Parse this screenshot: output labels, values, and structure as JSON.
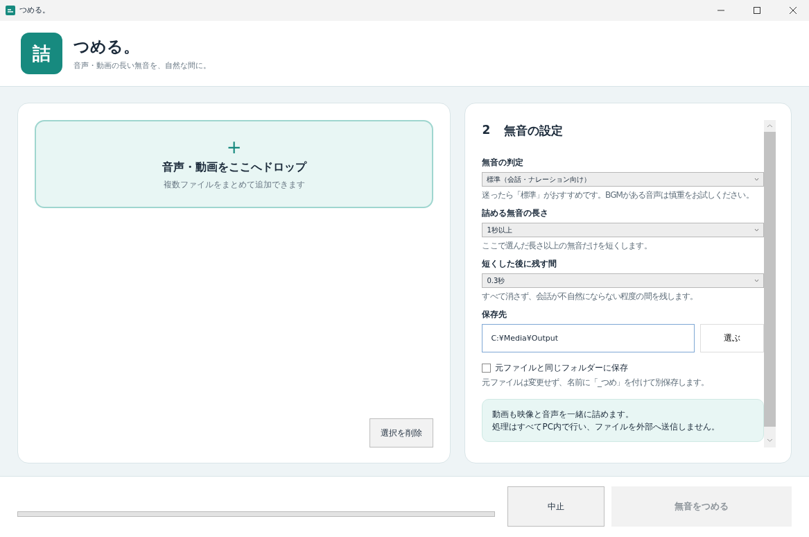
{
  "window": {
    "title": "つめる。"
  },
  "header": {
    "logo": "詰",
    "title": "つめる。",
    "subtitle": "音声・動画の長い無音を、自然な間に。"
  },
  "drop_zone": {
    "icon": "+",
    "title": "音声・動画をここへドロップ",
    "hint": "複数ファイルをまとめて追加できます"
  },
  "remove_button": {
    "label": "選択を削除",
    "disabled": false
  },
  "settings": {
    "number": "2",
    "title": "無音の設定",
    "fields": [
      {
        "kind": "select",
        "label": "無音の判定",
        "value": "標準（会話・ナレーション向け）",
        "hint": "迷ったら「標準」がおすすめです。BGMがある音声は慎重をお試しください。"
      },
      {
        "kind": "select",
        "label": "詰める無音の長さ",
        "value": "1秒以上",
        "hint": "ここで選んだ長さ以上の無音だけを短くします。"
      },
      {
        "kind": "select",
        "label": "短くした後に残す間",
        "value": "0.3秒",
        "hint": "すべて消さず、会話が不自然にならない程度の間を残します。"
      },
      {
        "kind": "folder",
        "label": "保存先",
        "value": "C:¥Media¥Output",
        "button": "選ぶ"
      },
      {
        "kind": "checkbox",
        "label": "元ファイルと同じフォルダーに保存",
        "checked": false,
        "hint": "元ファイルは変更せず、名前に「_つめ」を付けて別保存します。"
      }
    ],
    "notice": [
      "動画も映像と音声を一緒に詰めます。",
      "処理はすべてPC内で行い、ファイルを外部へ送信しません。"
    ]
  },
  "footer": {
    "progress": {
      "level": 0
    },
    "cancel": {
      "label": "中止",
      "disabled": false
    },
    "run": {
      "label": "無音をつめる",
      "disabled": true
    }
  }
}
